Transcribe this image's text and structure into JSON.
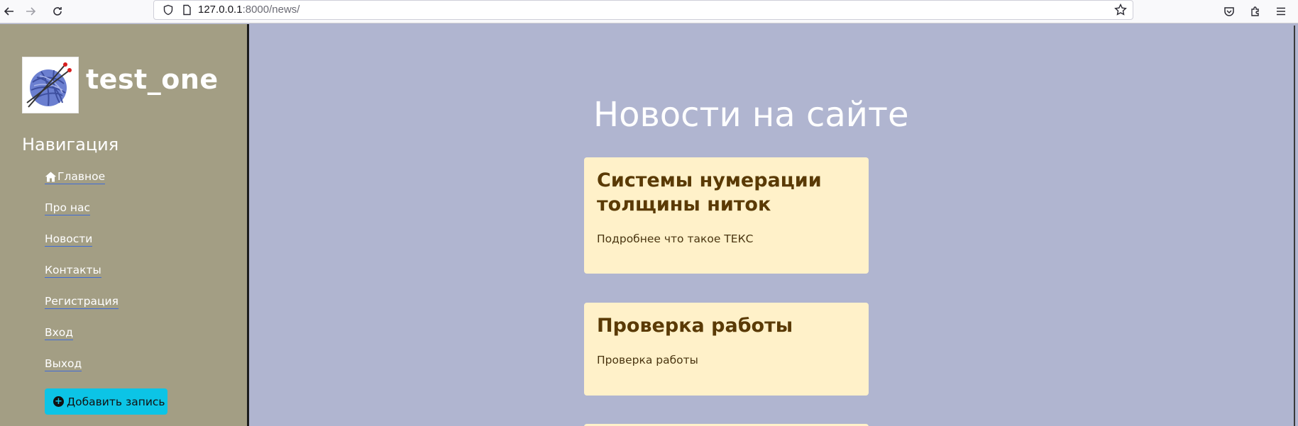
{
  "browser": {
    "url_host": "127.0.0.1",
    "url_path": ":8000/news/"
  },
  "sidebar": {
    "site_name": "test_one",
    "nav_title": "Навигация",
    "items": [
      {
        "label": "Главное"
      },
      {
        "label": "Про нас"
      },
      {
        "label": "Новости"
      },
      {
        "label": "Контакты"
      },
      {
        "label": "Регистрация"
      },
      {
        "label": "Вход"
      },
      {
        "label": "Выход"
      }
    ],
    "add_button_label": "Добавить запись"
  },
  "main": {
    "page_title": "Новости на сайте",
    "articles": [
      {
        "title": "Системы нумерации толщины ниток",
        "text": "Подробнее что такое ТЕКС"
      },
      {
        "title": "Проверка работы",
        "text": "Проверка работы"
      }
    ]
  },
  "colors": {
    "sidebar_bg": "#a39e84",
    "main_bg": "#b0b5d0",
    "card_bg": "#fff1c9",
    "card_title": "#5a3a05",
    "button_bg": "#0cc4e6"
  }
}
